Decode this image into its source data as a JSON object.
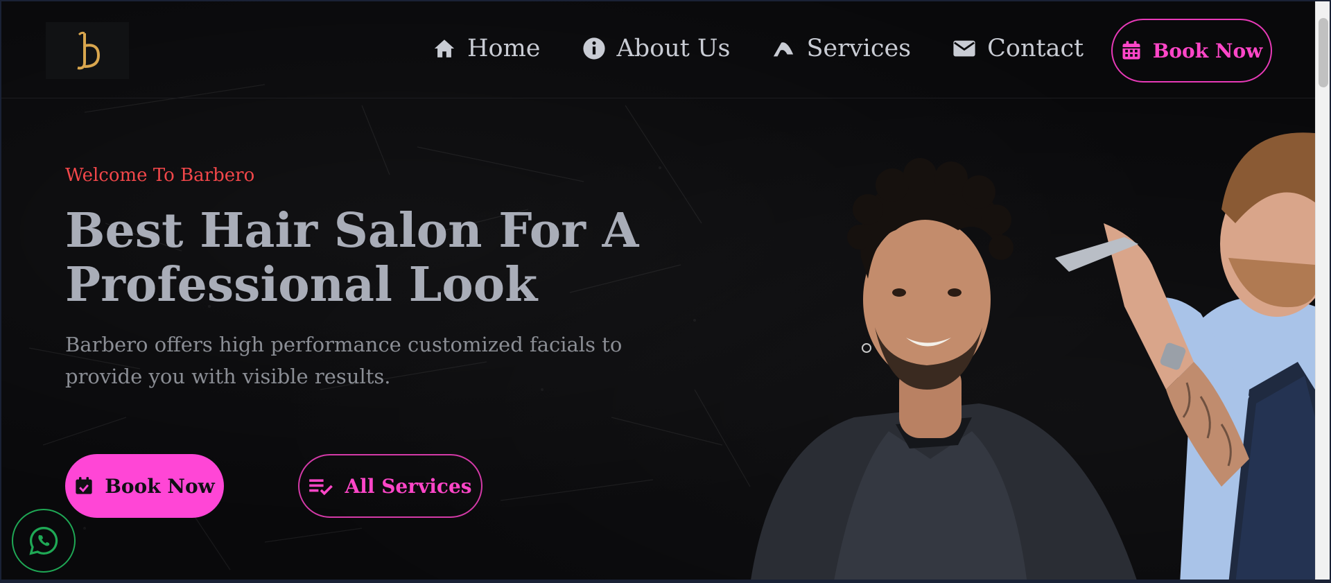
{
  "logo": {
    "text": "B",
    "icon": "barbero-logo"
  },
  "nav": {
    "items": [
      {
        "label": "Home",
        "icon": "home-icon"
      },
      {
        "label": "About Us",
        "icon": "info-icon"
      },
      {
        "label": "Services",
        "icon": "razor-icon"
      },
      {
        "label": "Contact",
        "icon": "envelope-icon"
      }
    ],
    "book_label": "Book Now"
  },
  "hero": {
    "eyebrow": "Welcome To Barbero",
    "headline_line1": "Best Hair Salon For A",
    "headline_line2": "Professional Look",
    "subtitle": "Barbero offers high performance customized facials to provide you with visible results.",
    "primary_button": "Book Now",
    "secondary_button": "All Services"
  },
  "colors": {
    "accent": "#ff46d6",
    "eyebrow": "#f2474a",
    "background": "#09090b",
    "whatsapp": "#1fa855"
  }
}
